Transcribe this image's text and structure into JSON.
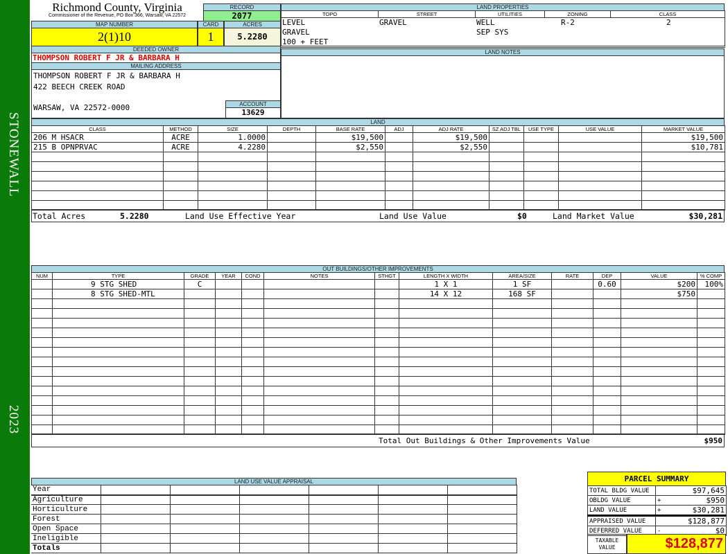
{
  "sidebar": {
    "district": "STONEWALL",
    "year": "2023"
  },
  "header": {
    "title": "Richmond County, Virginia",
    "subtitle": "Commissioner of the Revenue, PO Box 366, Warsaw, VA 22572",
    "record_label": "RECORD",
    "record": "2077",
    "map_label": "MAP NUMBER",
    "map": "2(1)10",
    "card_label": "CARD",
    "card": "1",
    "acres_label": "ACRES",
    "acres": "5.2280"
  },
  "land_properties": {
    "label": "LAND PROPERTIES",
    "headers": [
      "TOPO",
      "STREET",
      "UTILITIES",
      "ZONING",
      "CLASS"
    ],
    "topo": [
      "LEVEL",
      "GRAVEL",
      "100 + FEET"
    ],
    "street": "GRAVEL",
    "utilities": [
      "WELL",
      "SEP SYS"
    ],
    "zoning": "R-2",
    "class": "2"
  },
  "land_notes": {
    "label": "LAND NOTES"
  },
  "owner": {
    "deeded_label": "DEEDED OWNER",
    "deeded": "THOMPSON ROBERT F JR & BARBARA H",
    "mailing_label": "MAILING ADDRESS",
    "address": [
      "THOMPSON ROBERT F JR & BARBARA H",
      "422 BEECH CREEK ROAD",
      "WARSAW, VA 22572-0000"
    ],
    "account_label": "ACCOUNT",
    "account": "13629"
  },
  "land": {
    "label": "LAND",
    "headers": [
      "CLASS",
      "METHOD",
      "SIZE",
      "DEPTH",
      "BASE RATE",
      "ADJ",
      "ADJ RATE",
      "SZ ADJ TBL",
      "USE TYPE",
      "USE VALUE",
      "MARKET VALUE"
    ],
    "rows": [
      [
        "206 M HSACR",
        "ACRE",
        "1.0000",
        "",
        "$19,500",
        "",
        "$19,500",
        "",
        "",
        "",
        "$19,500"
      ],
      [
        "215 B OPNPRVAC",
        "ACRE",
        "4.2280",
        "",
        "$2,550",
        "",
        "$2,550",
        "",
        "",
        "",
        "$10,781"
      ]
    ],
    "total_acres_label": "Total Acres",
    "total_acres": "5.2280",
    "effective_year_label": "Land Use Effective Year",
    "use_value_label": "Land Use Value",
    "use_value": "$0",
    "market_label": "Land Market Value",
    "market": "$30,281"
  },
  "outbuildings": {
    "label": "OUT BUILDINGS/OTHER IMPROVEMENTS",
    "headers": [
      "NUM",
      "TYPE",
      "GRADE",
      "YEAR",
      "COND",
      "NOTES",
      "STHGT",
      "LENGTH X WIDTH",
      "AREA/SIZE",
      "RATE",
      "DEP",
      "VALUE",
      "% COMP"
    ],
    "rows": [
      [
        "",
        "9 STG SHED",
        "C",
        "",
        "",
        "",
        "",
        "1 X 1",
        "1 SF",
        "",
        "0.60",
        "$200",
        "100%"
      ],
      [
        "",
        "8 STG SHED-MTL",
        "",
        "",
        "",
        "",
        "",
        "14 X 12",
        "168 SF",
        "",
        "",
        "$750",
        ""
      ]
    ],
    "total_label": "Total Out Buildings & Other Improvements Value",
    "total": "$950"
  },
  "land_use": {
    "label": "LAND USE VALUE APPRAISAL",
    "rows": [
      "Year",
      "Agriculture",
      "Horticulture",
      "Forest",
      "Open Space",
      "Ineligible",
      "Totals"
    ]
  },
  "summary": {
    "title": "PARCEL SUMMARY",
    "rows": [
      {
        "label": "TOTAL BLDG VALUE",
        "sign": "",
        "value": "$97,645"
      },
      {
        "label": "OBLDG VALUE",
        "sign": "+",
        "value": "$950"
      },
      {
        "label": "LAND VALUE",
        "sign": "+",
        "value": "$30,281"
      },
      {
        "label": "APPRAISED VALUE",
        "sign": "",
        "value": "$128,877"
      },
      {
        "label": "DEFERRED VALUE",
        "sign": "-",
        "value": "$0"
      }
    ],
    "taxable_label": "TAXABLE VALUE",
    "taxable": "$128,877"
  }
}
